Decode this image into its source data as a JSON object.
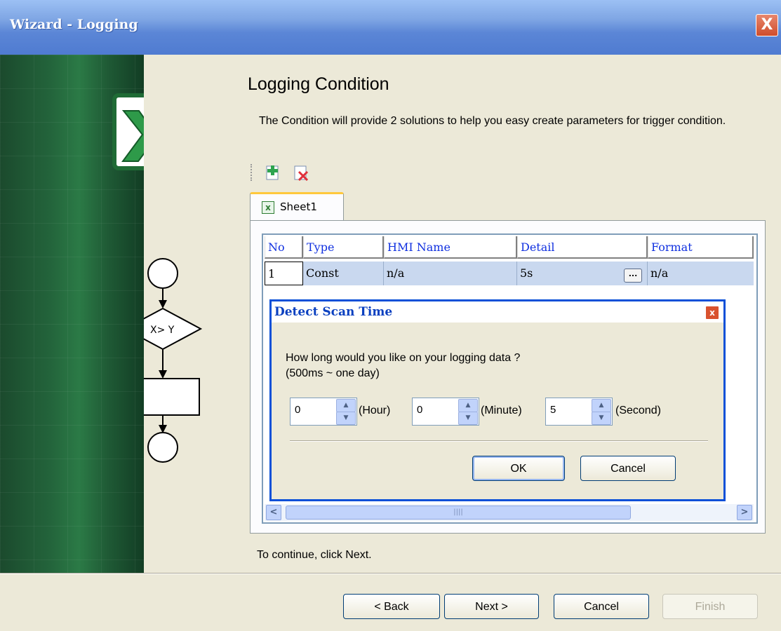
{
  "window": {
    "title": "Wizard - Logging",
    "close_label": "X"
  },
  "page": {
    "title": "Logging Condition",
    "description": "The Condition will provide 2 solutions to  help you easy create parameters for trigger condition.",
    "continue_hint": "To continue, click Next."
  },
  "flowchart": {
    "decision_label": "X> Y"
  },
  "toolbar": {
    "add_icon": "add-sheet-icon",
    "delete_icon": "delete-sheet-icon"
  },
  "tab": {
    "label": "Sheet1"
  },
  "table": {
    "headers": [
      "No",
      "Type",
      "HMI Name",
      "Detail",
      "Format"
    ],
    "rows": [
      {
        "no": "1",
        "type": "Const",
        "hmi_name": "n/a",
        "detail": "5s",
        "format": "n/a"
      }
    ],
    "ellipsis": "..."
  },
  "dialog": {
    "title": "Detect Scan Time",
    "question": "How long would you like on your logging data ?",
    "range": "(500ms ~  one day)",
    "hour_value": "0",
    "hour_unit": "(Hour)",
    "minute_value": "0",
    "minute_unit": "(Minute)",
    "second_value": "5",
    "second_unit": "(Second)",
    "ok": "OK",
    "cancel": "Cancel",
    "close_label": "x"
  },
  "footer": {
    "back": "< Back",
    "next": "Next >",
    "cancel": "Cancel",
    "finish": "Finish"
  },
  "colors": {
    "titlebar": "#5b86d6",
    "dialog_border": "#0a50d8",
    "selected_row": "#c9d8ef",
    "header_text": "#1030e0"
  }
}
